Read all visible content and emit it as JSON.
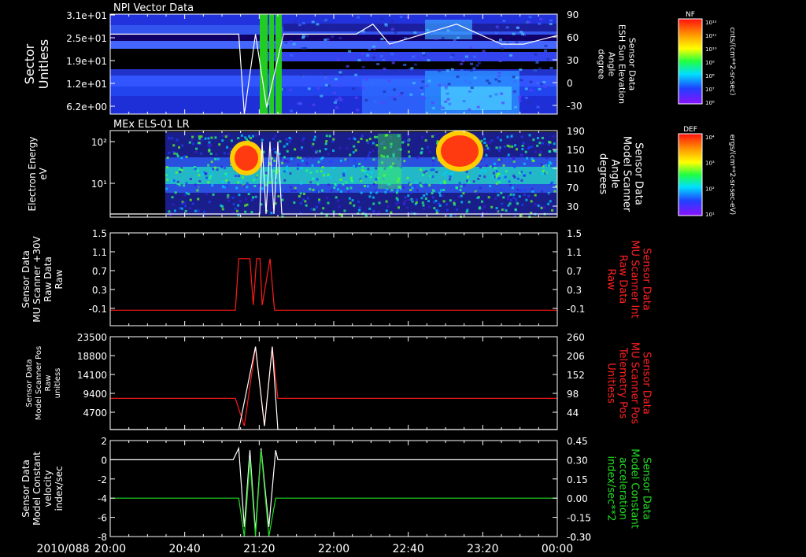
{
  "date_label": "2010/088",
  "time_ticks": [
    "20:00",
    "20:40",
    "21:20",
    "22:00",
    "22:40",
    "23:20",
    "00:00"
  ],
  "panels": [
    {
      "id": "npi",
      "title": "NPI Vector Data",
      "left_label": [
        "Sector",
        "Unitless"
      ],
      "left_ticks": [
        "3.1e+01",
        "2.5e+01",
        "1.9e+01",
        "1.2e+01",
        "6.2e+00"
      ],
      "right_label": [
        "Sensor Data",
        "ESH Sun Elevation",
        "Angle",
        "degree"
      ],
      "right_ticks": [
        "90",
        "60",
        "30",
        "0",
        "-30"
      ],
      "colorbar": {
        "label": "NF",
        "unit": "cnts/(cm**2-sr-sec)",
        "ticks": [
          "10¹²",
          "10¹¹",
          "10¹⁰",
          "10⁹",
          "10⁸",
          "10⁷",
          "10⁶"
        ]
      }
    },
    {
      "id": "els",
      "title": "MEx ELS-01 LR",
      "left_label": [
        "Electron Energy",
        "eV"
      ],
      "left_ticks": [
        "10²",
        "10¹"
      ],
      "right_label": [
        "Sensor Data",
        "Model Scanner",
        "Angle",
        "degrees"
      ],
      "right_ticks": [
        "190",
        "150",
        "110",
        "70",
        "30"
      ],
      "colorbar": {
        "label": "DEF",
        "unit": "ergs/(cm**2-sr-sec-eV)",
        "ticks": [
          "10⁴",
          "10³",
          "10²",
          "10¹"
        ]
      }
    },
    {
      "id": "mu_int",
      "left_label": [
        "Sensor Data",
        "MU Scanner +30V",
        "Raw Data",
        "Raw"
      ],
      "left_ticks": [
        "1.5",
        "1.1",
        "0.7",
        "0.3",
        "-0.1"
      ],
      "right_label": [
        "Sensor Data",
        "MU Scanner Int",
        "Raw Data",
        "Raw"
      ],
      "right_ticks": [
        "1.5",
        "1.1",
        "0.7",
        "0.3",
        "-0.1"
      ]
    },
    {
      "id": "mu_pos",
      "left_label": [
        "Sensor Data",
        "Model Scanner Pos",
        "Raw",
        "unitless"
      ],
      "left_ticks": [
        "23500",
        "18800",
        "14100",
        "9400",
        "4700"
      ],
      "right_label": [
        "Sensor Data",
        "MU Scanner Pos",
        "Telemetry Pos",
        "Unitless"
      ],
      "right_ticks": [
        "260",
        "206",
        "152",
        "98",
        "44"
      ]
    },
    {
      "id": "vel",
      "left_label": [
        "Sensor Data",
        "Model Constant",
        "velocity",
        "index/sec"
      ],
      "left_ticks": [
        "2",
        "0",
        "-2",
        "-4",
        "-6",
        "-8"
      ],
      "right_label": [
        "Sensor Data",
        "Model Constant",
        "acceleration",
        "index/sec**2"
      ],
      "right_ticks": [
        "0.45",
        "0.30",
        "0.15",
        "0.00",
        "-0.15",
        "-0.30"
      ]
    }
  ],
  "colors": {
    "red_label": "#ff2020",
    "green_label": "#22dd22",
    "trace_white": "#ffffff",
    "trace_red": "#ff1a1a",
    "trace_green": "#22dd22"
  },
  "chart_data": [
    {
      "type": "heatmap",
      "title": "NPI Vector Data",
      "ylabel": "Sector Unitless",
      "yticks": [
        "3.1e+01",
        "2.5e+01",
        "1.9e+01",
        "1.2e+01",
        "6.2e+00"
      ],
      "y2label": "Sensor Data ESH Sun Elevation Angle degree",
      "y2lim": [
        -60,
        90
      ],
      "overlay_line": {
        "name": "ESH Sun Elevation Angle",
        "x_hours": [
          20.0,
          21.15,
          21.2,
          21.3,
          21.4,
          21.55,
          22.2,
          22.35,
          22.5,
          22.9,
          23.1,
          23.5,
          23.7,
          24.0
        ],
        "y": [
          60,
          60,
          -60,
          60,
          -50,
          60,
          60,
          75,
          45,
          65,
          75,
          45,
          45,
          58
        ]
      },
      "colorbar": {
        "label": "NF",
        "scale": "log",
        "range": [
          "1e6",
          "1e12"
        ]
      }
    },
    {
      "type": "heatmap",
      "title": "MEx ELS-01 LR",
      "ylabel": "Electron Energy eV",
      "yscale": "log",
      "yticks": [
        "10²",
        "10¹"
      ],
      "y2label": "Sensor Data Model Scanner Angle degrees",
      "y2lim": [
        0,
        190
      ],
      "colorbar": {
        "label": "DEF",
        "scale": "log",
        "range": [
          "1e1",
          "1e4"
        ]
      }
    },
    {
      "type": "line",
      "ylabel": "Sensor Data MU Scanner +30V Raw Data Raw",
      "ylim": [
        -0.3,
        1.5
      ],
      "y2label": "Sensor Data MU Scanner Int Raw Data Raw",
      "series": [
        {
          "color": "#ff1a1a",
          "x_hours": [
            20.0,
            21.12,
            21.15,
            21.25,
            21.28,
            21.31,
            21.34,
            21.36,
            21.43,
            21.47,
            24.0
          ],
          "y": [
            0.0,
            0.0,
            1.0,
            1.0,
            0.1,
            1.0,
            1.0,
            0.1,
            1.0,
            0.0,
            0.0
          ]
        }
      ]
    },
    {
      "type": "line",
      "ylabel": "Sensor Data Model Scanner Pos Raw unitless",
      "ylim": [
        0,
        23500
      ],
      "y2label": "Sensor Data MU Scanner Pos Telemetry Pos Unitless",
      "y2lim": [
        0,
        260
      ],
      "series": [
        {
          "color": "#ff1a1a",
          "x_hours": [
            20.0,
            21.12,
            21.2,
            21.3,
            21.38,
            21.45,
            21.5,
            24.0
          ],
          "y": [
            7900,
            7900,
            900,
            21000,
            900,
            21000,
            7900,
            7900
          ]
        },
        {
          "color": "#ffffff",
          "x_hours": [
            20.0,
            21.15,
            21.3,
            21.38,
            21.45,
            21.5,
            24.0
          ],
          "y": [
            0,
            0,
            21000,
            900,
            21000,
            0,
            0
          ]
        }
      ]
    },
    {
      "type": "line",
      "ylabel": "Sensor Data Model Constant velocity index/sec",
      "ylim": [
        -8,
        2
      ],
      "y2label": "Sensor Data Model Constant acceleration index/sec**2",
      "y2lim": [
        -0.3,
        0.45
      ],
      "series": [
        {
          "color": "#ffffff",
          "x_hours": [
            20.0,
            21.1,
            21.15,
            21.2,
            21.25,
            21.3,
            21.35,
            21.42,
            21.48,
            21.5,
            24.0
          ],
          "y": [
            0,
            0,
            1.2,
            -7.0,
            1.0,
            -7.5,
            1.2,
            -7.0,
            1.0,
            0,
            0
          ]
        },
        {
          "color": "#22dd22",
          "x_hours": [
            20.0,
            21.15,
            21.2,
            21.25,
            21.3,
            21.35,
            21.42,
            21.48,
            24.0
          ],
          "y": [
            -4,
            -4,
            -8,
            0,
            -8,
            1,
            -8,
            -4,
            -4
          ]
        }
      ]
    }
  ]
}
